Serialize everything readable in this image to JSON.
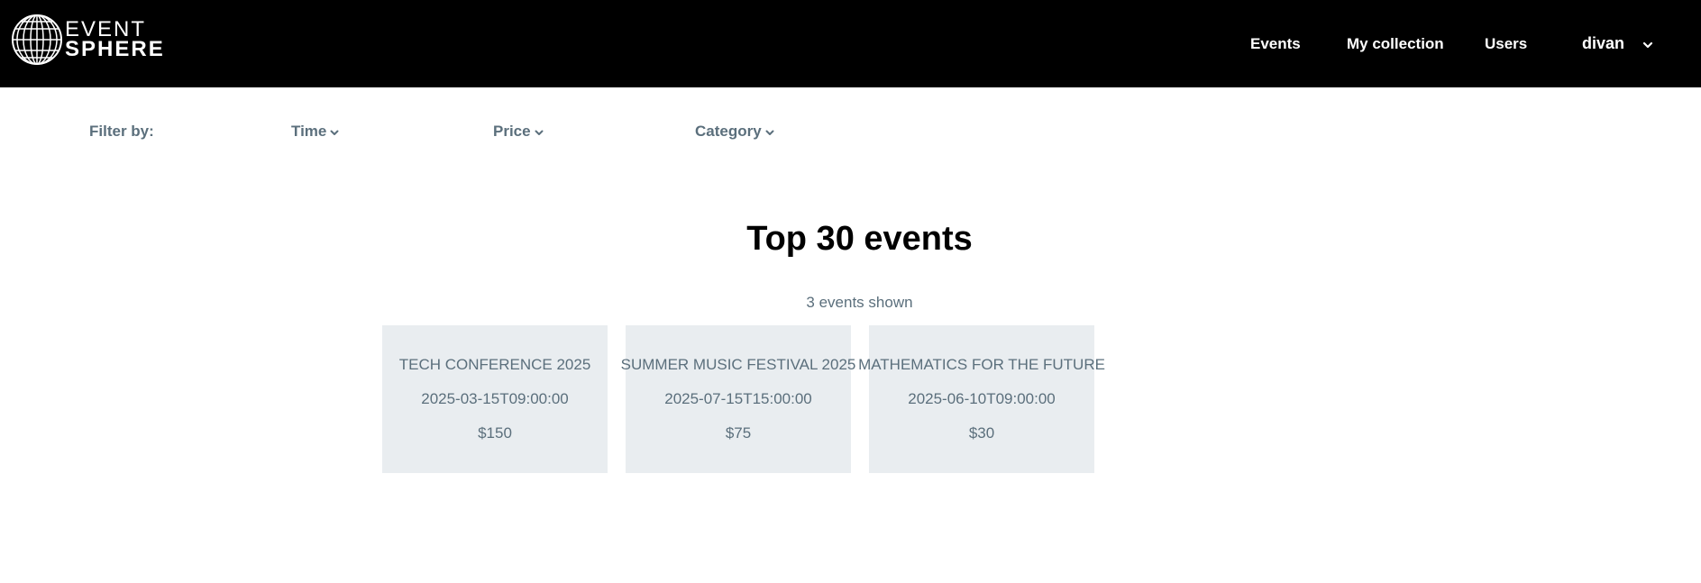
{
  "header": {
    "logo": {
      "line1": "EVENT",
      "line2": "SPHERE",
      "icon": "globe-icon"
    },
    "nav": {
      "events": "Events",
      "my_collection": "My collection",
      "users": "Users",
      "username": "divan",
      "user_menu_icon": "chevron-down-icon"
    }
  },
  "filters": {
    "label": "Filter by:",
    "time": "Time",
    "price": "Price",
    "category": "Category",
    "dropdown_icon": "chevron-down-icon"
  },
  "main": {
    "title": "Top 30 events",
    "count_text": "3 events shown",
    "events": [
      {
        "name": "TECH CONFERENCE 2025",
        "datetime": "2025-03-15T09:00:00",
        "price": "$150"
      },
      {
        "name": "SUMMER MUSIC FESTIVAL 2025",
        "datetime": "2025-07-15T15:00:00",
        "price": "$75"
      },
      {
        "name": "MATHEMATICS FOR THE FUTURE",
        "datetime": "2025-06-10T09:00:00",
        "price": "$30"
      }
    ]
  },
  "colors": {
    "header_bg": "#000000",
    "muted_text": "#5b6f7c",
    "card_bg": "#e9edf0"
  }
}
